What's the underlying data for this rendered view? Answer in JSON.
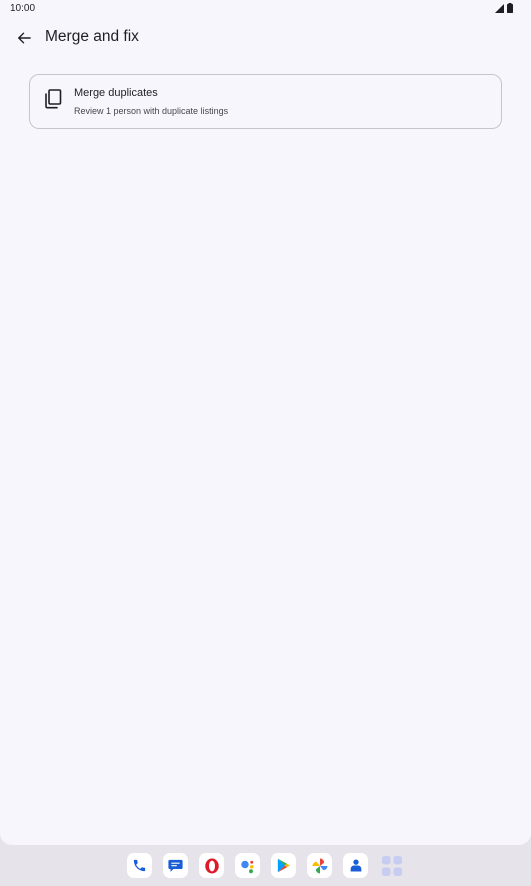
{
  "status_bar": {
    "time": "10:00",
    "icons": [
      "signal-icon",
      "battery-icon"
    ]
  },
  "app_bar": {
    "title": "Merge and fix",
    "back_icon": "arrow-back-icon"
  },
  "card": {
    "icon": "copy-icon",
    "title": "Merge duplicates",
    "subtitle": "Review 1 person with duplicate listings"
  },
  "dock": {
    "apps": [
      {
        "name": "phone-app",
        "icon": "phone-icon"
      },
      {
        "name": "messages-app",
        "icon": "messages-icon"
      },
      {
        "name": "opera-app",
        "icon": "opera-icon"
      },
      {
        "name": "assistant-app",
        "icon": "assistant-icon"
      },
      {
        "name": "play-store-app",
        "icon": "play-store-icon"
      },
      {
        "name": "photos-app",
        "icon": "photos-icon"
      },
      {
        "name": "contacts-app",
        "icon": "contacts-icon"
      },
      {
        "name": "app-drawer",
        "icon": "apps-grid-icon"
      }
    ]
  },
  "colors": {
    "background": "#f7f6fd",
    "nav_background": "#e7e3ea",
    "card_border": "#c6c5cf",
    "text_primary": "#1f1f23",
    "text_secondary": "#47464f"
  }
}
